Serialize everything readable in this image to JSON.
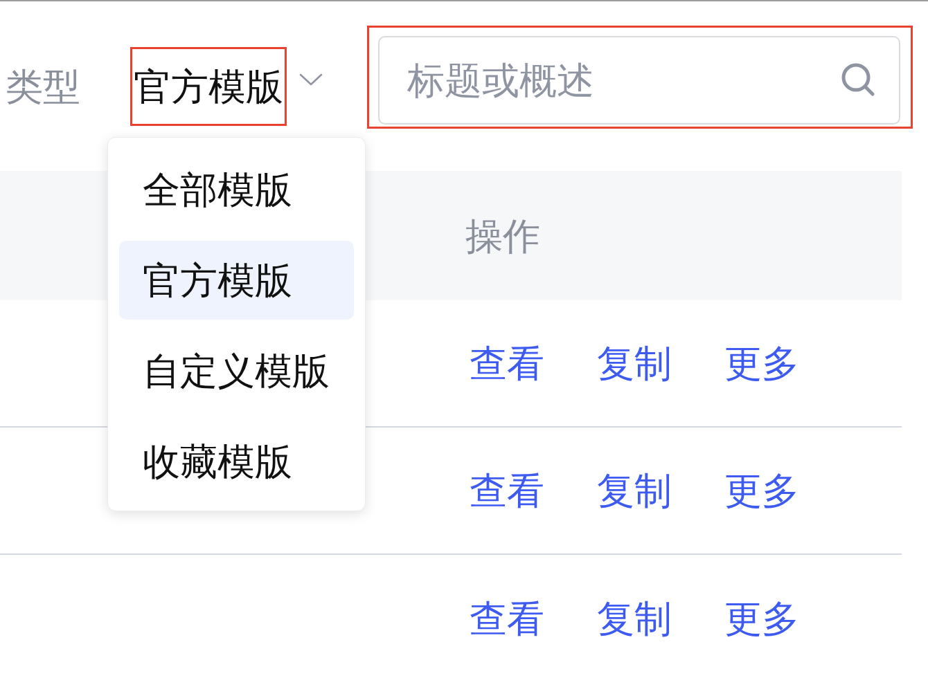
{
  "filter": {
    "label": "类型",
    "value": "官方模版",
    "annotated": true
  },
  "search": {
    "placeholder": "标题或概述",
    "annotated": true
  },
  "dropdown": {
    "items": [
      {
        "label": "全部模版",
        "selected": false
      },
      {
        "label": "官方模版",
        "selected": true
      },
      {
        "label": "自定义模版",
        "selected": false
      },
      {
        "label": "收藏模版",
        "selected": false
      }
    ]
  },
  "table": {
    "columns": [
      {
        "label": "操作"
      }
    ],
    "rows": [
      {
        "actions": [
          "查看",
          "复制",
          "更多"
        ]
      },
      {
        "actions": [
          "查看",
          "复制",
          "更多"
        ]
      },
      {
        "actions": [
          "查看",
          "复制",
          "更多"
        ]
      }
    ]
  }
}
